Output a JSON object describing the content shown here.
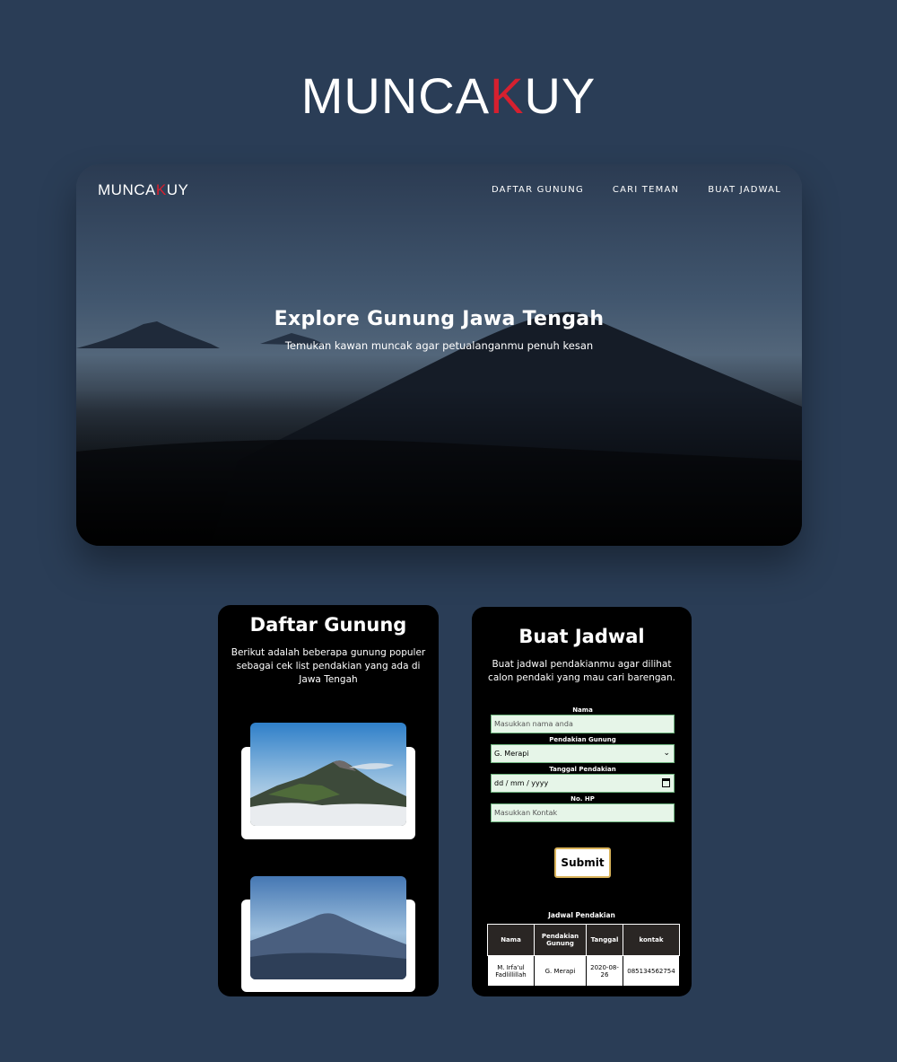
{
  "brand": {
    "prefix": "MUNCA",
    "highlight": "K",
    "suffix": "UY"
  },
  "hero": {
    "logo": {
      "prefix": "MUNCA",
      "highlight": "K",
      "suffix": "UY"
    },
    "nav": [
      "DAFTAR GUNUNG",
      "CARI TEMAN",
      "BUAT JADWAL"
    ],
    "title": "Explore Gunung Jawa Tengah",
    "subtitle": "Temukan kawan muncak agar petualanganmu penuh kesan"
  },
  "daftar": {
    "title": "Daftar Gunung",
    "description": "Berikut adalah beberapa gunung populer sebagai cek list pendakian yang ada di Jawa Tengah"
  },
  "jadwal": {
    "title": "Buat Jadwal",
    "description": "Buat jadwal pendakianmu agar dilihat calon pendaki yang mau cari barengan.",
    "form": {
      "nama_label": "Nama",
      "nama_placeholder": "Masukkan nama anda",
      "gunung_label": "Pendakian Gunung",
      "gunung_value": "G. Merapi",
      "tanggal_label": "Tanggal Pendakian",
      "tanggal_placeholder": "dd / mm / yyyy",
      "hp_label": "No. HP",
      "hp_placeholder": "Masukkan Kontak",
      "submit_label": "Submit"
    },
    "table": {
      "title": "Jadwal Pendakian",
      "headers": [
        "Nama",
        "Pendakian Gunung",
        "Tanggal",
        "kontak"
      ],
      "rows": [
        [
          "M. Irfa'ul Fadlillillah",
          "G. Merapi",
          "2020-08-26",
          "085134562754"
        ]
      ]
    }
  }
}
